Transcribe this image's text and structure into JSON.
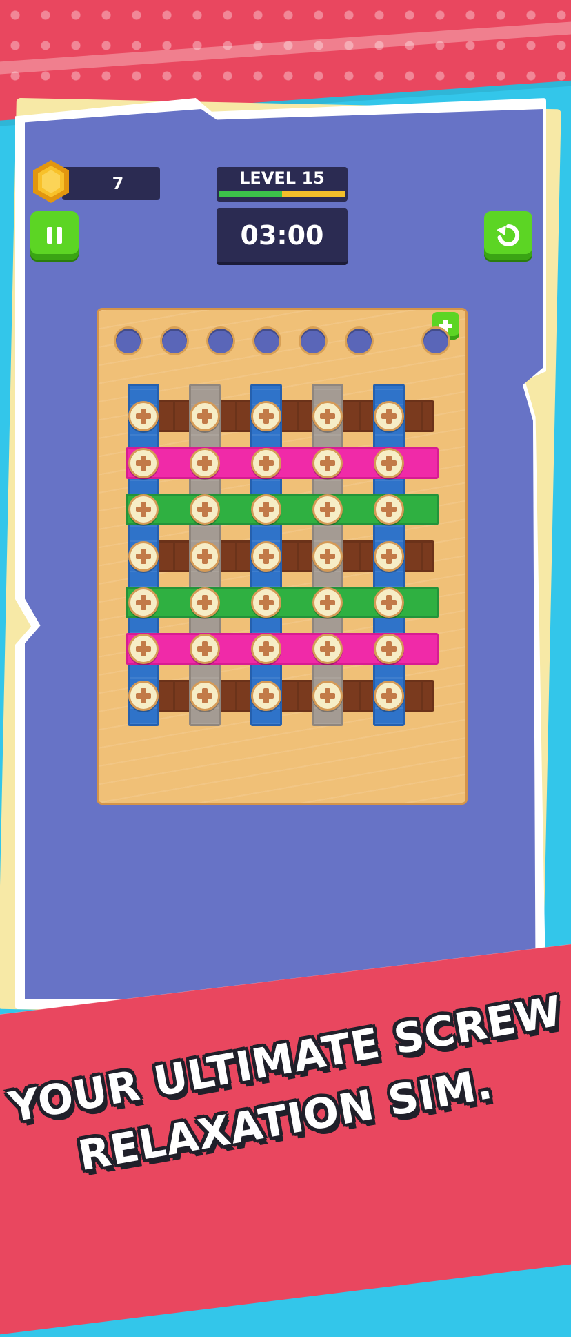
{
  "hud": {
    "coins": "7",
    "level_label": "LEVEL 15",
    "level_progress": 0.5,
    "timer": "03:00"
  },
  "icons": {
    "pause": "pause-icon",
    "restart": "restart-icon",
    "coin": "hex-coin-icon",
    "add_hole": "plus-icon",
    "screw": "cross-screw-icon"
  },
  "colors": {
    "panel": "#6773c6",
    "board": "#f0c077",
    "brown": "#7a3a1e",
    "pink": "#f02aa8",
    "green": "#2fb041",
    "blue": "#2f73c9",
    "gray": "#a49b93",
    "button_green": "#5cd524",
    "banner": "#e9475f"
  },
  "board": {
    "holes": 7,
    "extra_hole_locked": true,
    "vertical_planks": [
      "blue",
      "gray",
      "blue",
      "gray",
      "blue"
    ],
    "horizontal_planks": [
      "brown",
      "pink",
      "green",
      "brown",
      "green",
      "pink",
      "brown"
    ],
    "screws_per_row": 5
  },
  "slogan": {
    "line1": "YOUR ULTIMATE SCREW",
    "line2": "RELAXATION SIM."
  }
}
